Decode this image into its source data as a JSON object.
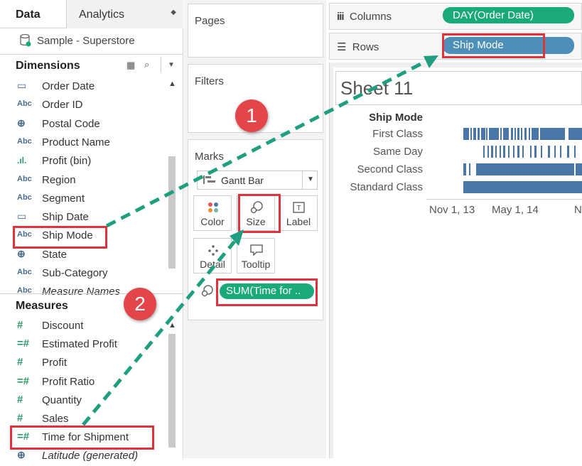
{
  "data_pane": {
    "tabs": [
      {
        "label": "Data"
      },
      {
        "label": "Analytics"
      }
    ],
    "datasource": "Sample - Superstore",
    "dimensions_title": "Dimensions",
    "dimensions": [
      {
        "icon": "calendar-icon",
        "type": "",
        "label": "Order Date"
      },
      {
        "icon": "abc-icon",
        "type": "Abc",
        "label": "Order ID"
      },
      {
        "icon": "globe-icon",
        "type": "",
        "label": "Postal Code"
      },
      {
        "icon": "abc-icon",
        "type": "Abc",
        "label": "Product Name"
      },
      {
        "icon": "bin-icon",
        "type": "",
        "label": "Profit (bin)"
      },
      {
        "icon": "abc-icon",
        "type": "Abc",
        "label": "Region"
      },
      {
        "icon": "abc-icon",
        "type": "Abc",
        "label": "Segment"
      },
      {
        "icon": "calendar-icon",
        "type": "",
        "label": "Ship Date"
      },
      {
        "icon": "abc-icon",
        "type": "Abc",
        "label": "Ship Mode"
      },
      {
        "icon": "globe-icon",
        "type": "",
        "label": "State"
      },
      {
        "icon": "abc-icon",
        "type": "Abc",
        "label": "Sub-Category"
      },
      {
        "icon": "abc-icon",
        "type": "Abc",
        "label": "Measure Names"
      }
    ],
    "measures_title": "Measures",
    "measures": [
      {
        "icon": "number-icon",
        "type": "#",
        "label": "Discount"
      },
      {
        "icon": "calc-number-icon",
        "type": "=#",
        "label": "Estimated Profit"
      },
      {
        "icon": "number-icon",
        "type": "#",
        "label": "Profit"
      },
      {
        "icon": "calc-number-icon",
        "type": "=#",
        "label": "Profit Ratio"
      },
      {
        "icon": "number-icon",
        "type": "#",
        "label": "Quantity"
      },
      {
        "icon": "number-icon",
        "type": "#",
        "label": "Sales"
      },
      {
        "icon": "calc-number-icon",
        "type": "=#",
        "label": "Time for Shipment"
      },
      {
        "icon": "globe-icon",
        "type": "",
        "label": "Latitude (generated)"
      }
    ]
  },
  "cards": {
    "pages": "Pages",
    "filters": "Filters",
    "marks": "Marks",
    "mark_type": "Gantt Bar",
    "buttons": [
      {
        "label": "Color",
        "icon": "color-icon"
      },
      {
        "label": "Size",
        "icon": "size-icon"
      },
      {
        "label": "Label",
        "icon": "label-icon"
      },
      {
        "label": "Detail",
        "icon": "detail-icon"
      },
      {
        "label": "Tooltip",
        "icon": "tooltip-icon"
      }
    ],
    "size_pill": "SUM(Time for .."
  },
  "shelves": {
    "columns_label": "Columns",
    "columns_pill": "DAY(Order Date)",
    "rows_label": "Rows",
    "rows_pill": "Ship Mode"
  },
  "view": {
    "sheet_title": "Sheet 11",
    "row_header": "Ship Mode",
    "rows": [
      "First Class",
      "Same Day",
      "Second Class",
      "Standard Class"
    ],
    "x_ticks": [
      "Nov 1, 13",
      "May 1, 14",
      "N"
    ]
  },
  "annotations": {
    "badge1": "1",
    "badge2": "2"
  },
  "colors": {
    "bar": "#4a77a8",
    "pill_green": "#1aa97a",
    "pill_blue": "#4d8fb7",
    "highlight": "#e0323a",
    "arrow": "#1f9e80"
  }
}
